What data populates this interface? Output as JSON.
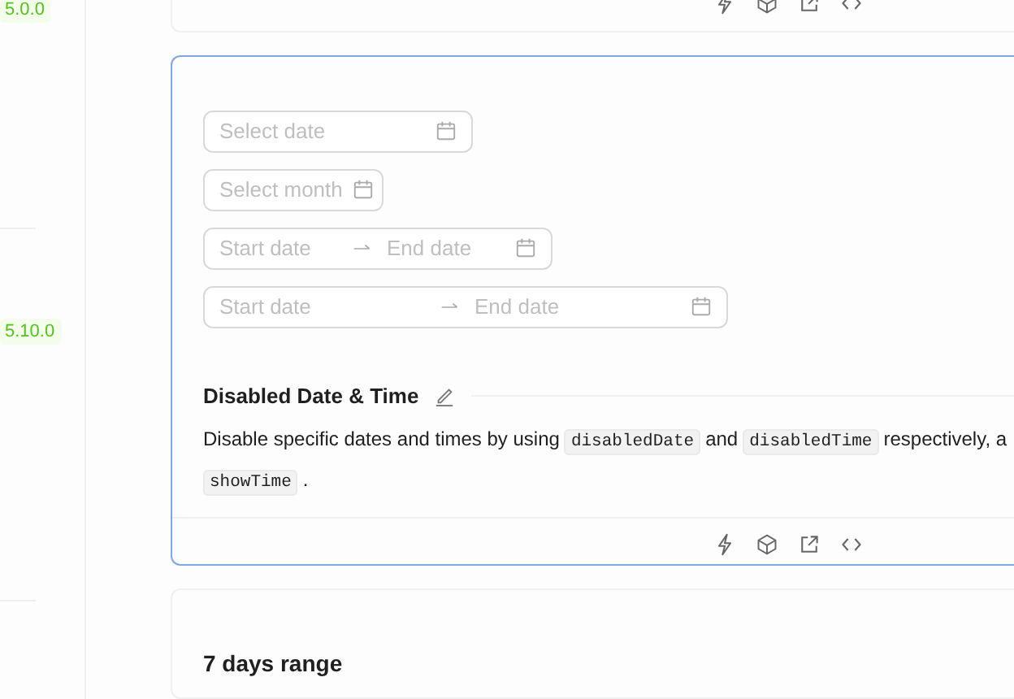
{
  "sidebar": {
    "versions": [
      {
        "label": "5.0.0"
      },
      {
        "label": "5.10.0"
      }
    ]
  },
  "demo_card": {
    "active": true,
    "pickers": [
      {
        "kind": "date",
        "placeholder": "Select date"
      },
      {
        "kind": "month",
        "placeholder": "Select month"
      },
      {
        "kind": "range",
        "start_placeholder": "Start date",
        "end_placeholder": "End date"
      },
      {
        "kind": "datetime-range",
        "start_placeholder": "Start date",
        "end_placeholder": "End date"
      }
    ],
    "title": "Disabled Date & Time",
    "description_lines": [
      [
        {
          "kind": "text",
          "text": "Disable specific dates and times by using"
        },
        {
          "kind": "code",
          "text": "disabledDate"
        },
        {
          "kind": "text",
          "text": "and"
        },
        {
          "kind": "code",
          "text": "disabledTime"
        },
        {
          "kind": "text",
          "text": "respectively, a"
        }
      ],
      [
        {
          "kind": "code",
          "text": "showTime"
        },
        {
          "kind": "text",
          "text": "."
        }
      ]
    ]
  },
  "next_card": {
    "title": "7 days range"
  }
}
